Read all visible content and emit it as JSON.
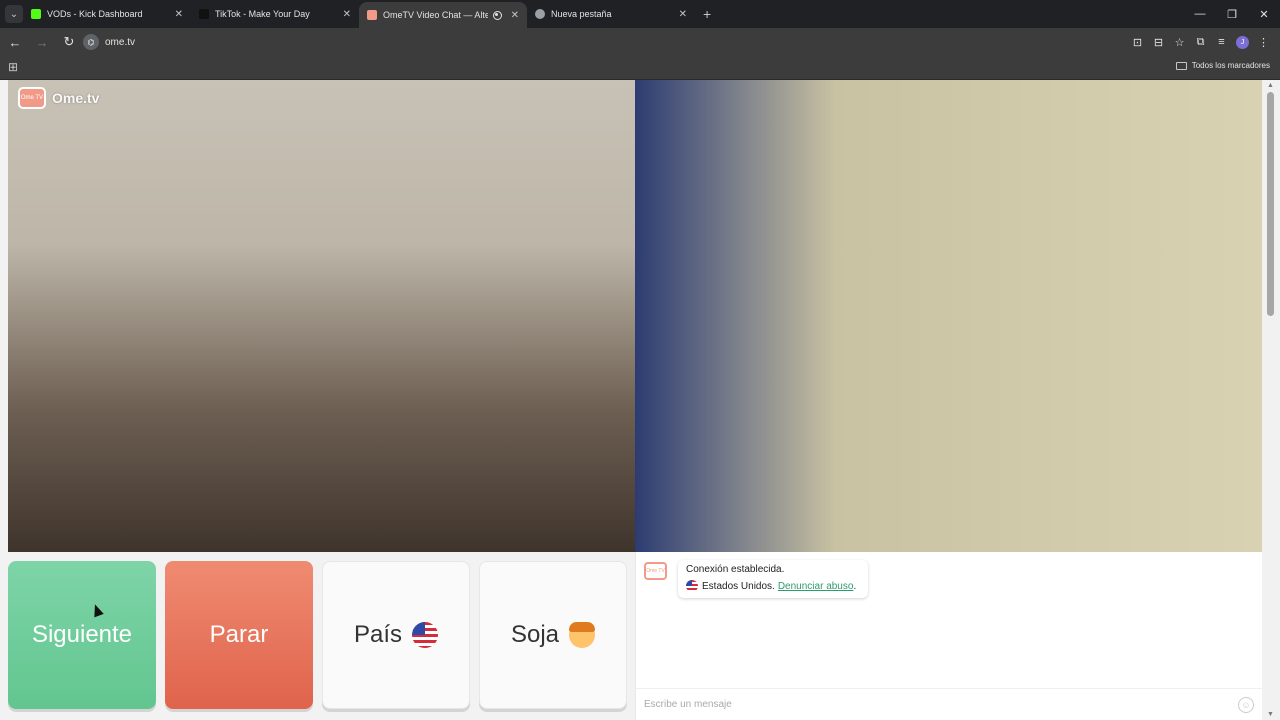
{
  "tabs": [
    {
      "label": "VODs - Kick Dashboard",
      "favicon_color": "#53fc18",
      "active": false
    },
    {
      "label": "TikTok - Make Your Day",
      "favicon_color": "#111111",
      "active": false
    },
    {
      "label": "OmeTV Video Chat — Alter",
      "favicon_color": "#f19a88",
      "active": true
    },
    {
      "label": "Nueva pestaña",
      "favicon_color": "#9aa0a6",
      "active": false
    }
  ],
  "tab_menu_icon": "chevron-down-icon",
  "new_tab_icon": "plus-icon",
  "window_controls": {
    "minimize": "—",
    "maximize": "❐",
    "close": "✕"
  },
  "toolbar": {
    "back": "←",
    "forward": "→",
    "reload": "↻",
    "url": "ome.tv",
    "site_icon": "⌬"
  },
  "toolbar_right": {
    "translate": "⊡",
    "cast": "⊟",
    "bookmark": "☆",
    "extensions": "⧉",
    "media": "≡",
    "avatar": "J",
    "menu": "⋮"
  },
  "bookmarks_bar": {
    "all_bookmarks": "Todos los marcadores"
  },
  "brand": {
    "badge": "Ome TV",
    "name": "Ome.tv"
  },
  "controls": {
    "next_label": "Siguiente",
    "stop_label": "Parar",
    "country_label": "País",
    "gender_label": "Soja"
  },
  "chat": {
    "logo": "Ome TV",
    "status": "Conexión establecida.",
    "country": "Estados Unidos",
    "separator": " .",
    "report_link": "Denunciar abuso",
    "report_suffix": ".",
    "input_placeholder": "Escribe un mensaje",
    "emoji_icon": "☺"
  },
  "colors": {
    "next": "#62c68f",
    "stop": "#e0634c",
    "brand": "#f19a88",
    "link": "#2d9b6e"
  }
}
